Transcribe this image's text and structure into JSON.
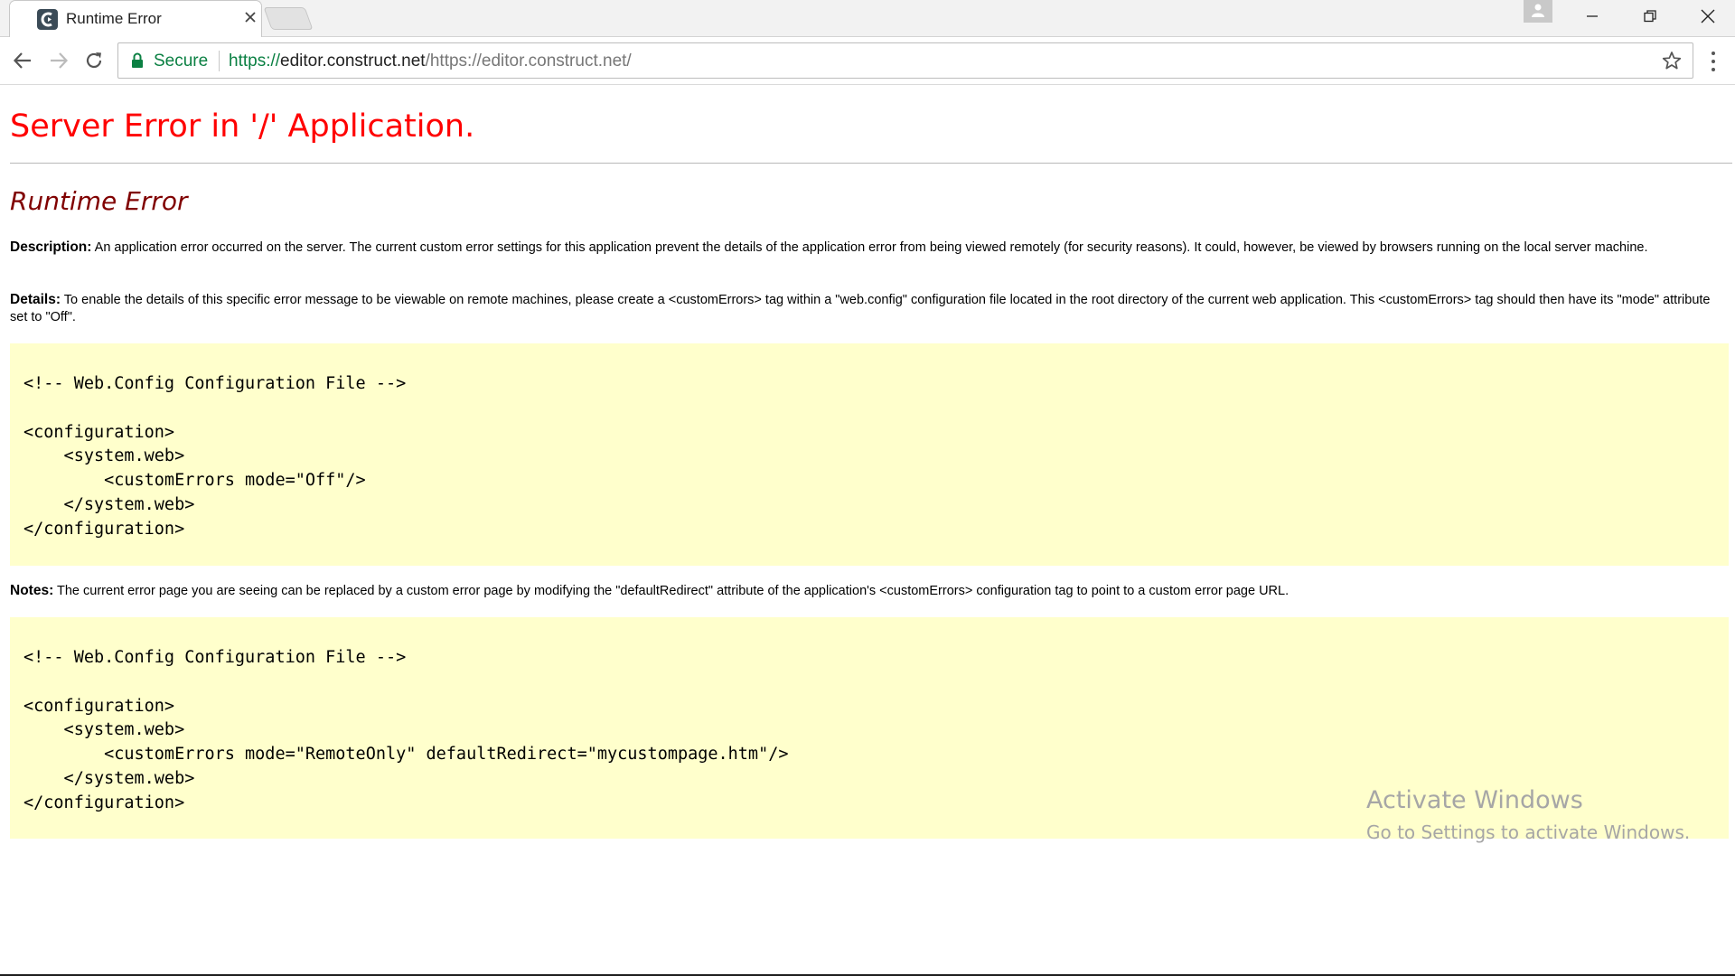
{
  "browser": {
    "tab": {
      "title": "Runtime Error",
      "favicon_icon": "construct-logo-icon",
      "close_icon": "close-icon"
    },
    "new_tab_icon": "new-tab-icon",
    "profile_icon": "profile-person-icon",
    "window_controls": {
      "minimize_icon": "minimize-icon",
      "restore_icon": "restore-icon",
      "close_icon": "close-icon"
    },
    "toolbar": {
      "back_icon": "back-arrow-icon",
      "forward_icon": "forward-arrow-icon",
      "reload_icon": "reload-icon",
      "security_label": "Secure",
      "url_scheme": "https://",
      "url_host": "editor.construct.net",
      "url_path": "/https://editor.construct.net/",
      "bookmark_icon": "star-icon",
      "menu_icon": "more-vertical-icon"
    },
    "colors": {
      "secure_green": "#0b8043",
      "title_red": "#ff0000",
      "subtitle_maroon": "#800000",
      "code_background": "#ffffcc"
    }
  },
  "page": {
    "title": "Server Error in '/' Application.",
    "subtitle": "Runtime Error",
    "description": {
      "label": "Description:",
      "text": "An application error occurred on the server. The current custom error settings for this application prevent the details of the application error from being viewed remotely (for security reasons). It could, however, be viewed by browsers running on the local server machine."
    },
    "details": {
      "label": "Details:",
      "text": "To enable the details of this specific error message to be viewable on remote machines, please create a <customErrors> tag within a \"web.config\" configuration file located in the root directory of the current web application. This <customErrors> tag should then have its \"mode\" attribute set to \"Off\"."
    },
    "code_block_1": [
      "<!-- Web.Config Configuration File -->",
      "",
      "<configuration>",
      "    <system.web>",
      "        <customErrors mode=\"Off\"/>",
      "    </system.web>",
      "</configuration>"
    ],
    "notes": {
      "label": "Notes:",
      "text": "The current error page you are seeing can be replaced by a custom error page by modifying the \"defaultRedirect\" attribute of the application's <customErrors> configuration tag to point to a custom error page URL."
    },
    "code_block_2": [
      "<!-- Web.Config Configuration File -->",
      "",
      "<configuration>",
      "    <system.web>",
      "        <customErrors mode=\"RemoteOnly\" defaultRedirect=\"mycustompage.htm\"/>",
      "    </system.web>",
      "</configuration>"
    ]
  },
  "watermark": {
    "title": "Activate Windows",
    "subtitle": "Go to Settings to activate Windows."
  }
}
